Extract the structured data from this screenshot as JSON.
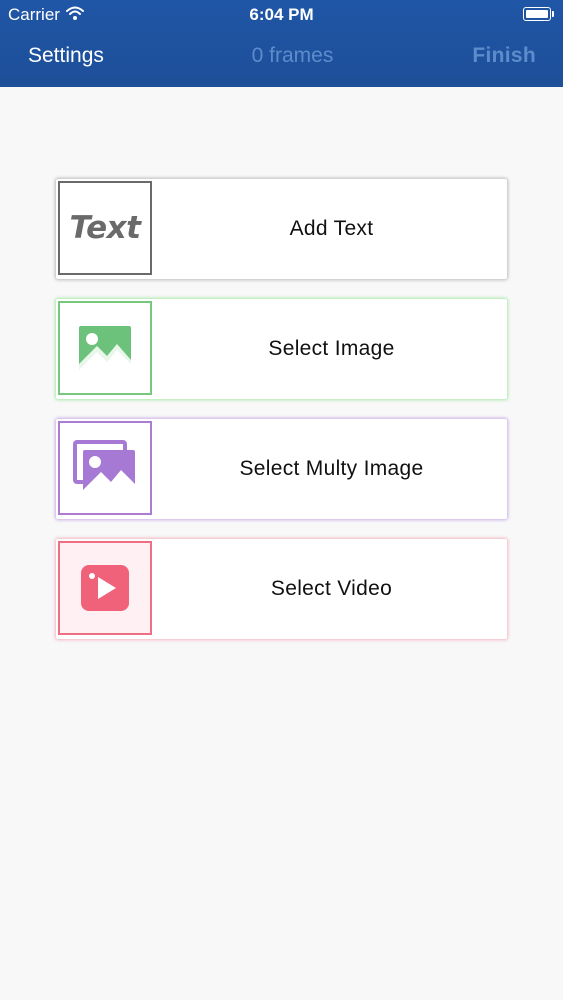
{
  "status_bar": {
    "carrier": "Carrier",
    "time": "6:04 PM",
    "wifi_icon": "wifi-icon",
    "battery_icon": "battery-icon"
  },
  "nav": {
    "left_label": "Settings",
    "title": "0 frames",
    "right_label": "Finish"
  },
  "actions": [
    {
      "label": "Add Text",
      "icon": "text-icon",
      "icon_text": "Text",
      "color": "#6a6a6a"
    },
    {
      "label": "Select Image",
      "icon": "image-icon",
      "color": "#76c87f"
    },
    {
      "label": "Select Multy Image",
      "icon": "multi-image-icon",
      "color": "#ac7bd3"
    },
    {
      "label": "Select Video",
      "icon": "video-icon",
      "color": "#ef6f82"
    }
  ],
  "colors": {
    "nav_bar": "#1f56a6",
    "nav_inactive_text": "#5d8ccc",
    "background": "#f8f8f9"
  }
}
